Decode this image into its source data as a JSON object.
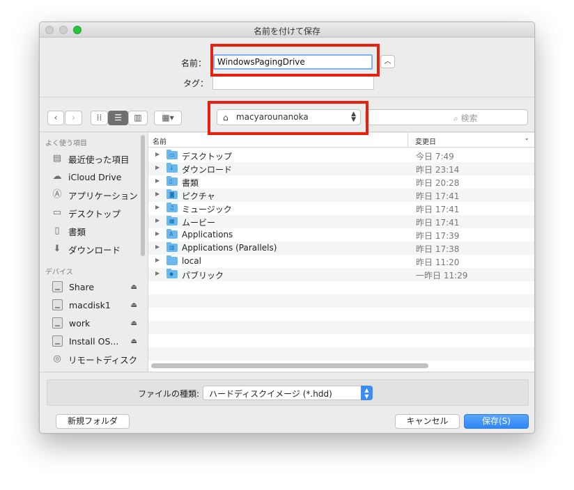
{
  "window": {
    "title": "名前を付けて保存"
  },
  "save_form": {
    "name_label": "名前：",
    "name_value": "WindowsPagingDrive",
    "tag_label": "タグ：",
    "tag_value": "",
    "expand_icon": "chevron-up-icon"
  },
  "toolbar": {
    "back_icon": "‹",
    "forward_icon": "›",
    "location": "macyarounanoka",
    "search_placeholder": "検索"
  },
  "sidebar": {
    "favorites_header": "よく使う項目",
    "favorites": [
      {
        "label": "最近使った項目",
        "icon": "recent-icon"
      },
      {
        "label": "iCloud Drive",
        "icon": "cloud-icon"
      },
      {
        "label": "アプリケーション",
        "icon": "applications-icon"
      },
      {
        "label": "デスクトップ",
        "icon": "desktop-icon"
      },
      {
        "label": "書類",
        "icon": "documents-icon"
      },
      {
        "label": "ダウンロード",
        "icon": "download-icon"
      }
    ],
    "devices_header": "デバイス",
    "devices": [
      {
        "label": "Share",
        "icon": "disk-icon"
      },
      {
        "label": "macdisk1",
        "icon": "disk-icon"
      },
      {
        "label": "work",
        "icon": "disk-icon"
      },
      {
        "label": "Install OS...",
        "icon": "disk-icon"
      },
      {
        "label": "リモートディスク",
        "icon": "remote-disc-icon"
      }
    ]
  },
  "file_list": {
    "col_name": "名前",
    "col_date": "変更日",
    "rows": [
      {
        "name": "デスクトップ",
        "date": "今日 7:49",
        "glyph": "▭"
      },
      {
        "name": "ダウンロード",
        "date": "昨日 23:14",
        "glyph": "↓"
      },
      {
        "name": "書類",
        "date": "昨日 20:28",
        "glyph": "▯"
      },
      {
        "name": "ピクチャ",
        "date": "昨日 17:41",
        "glyph": "◙"
      },
      {
        "name": "ミュージック",
        "date": "昨日 17:41",
        "glyph": "♫"
      },
      {
        "name": "ムービー",
        "date": "昨日 17:41",
        "glyph": "▦"
      },
      {
        "name": "Applications",
        "date": "昨日 17:39",
        "glyph": "A"
      },
      {
        "name": "Applications (Parallels)",
        "date": "昨日 17:38",
        "glyph": "▥"
      },
      {
        "name": "local",
        "date": "昨日 11:20",
        "glyph": ""
      },
      {
        "name": "パブリック",
        "date": "一昨日 11:29",
        "glyph": "◆"
      }
    ]
  },
  "format": {
    "label": "ファイルの種類:",
    "value": "ハードディスクイメージ (*.hdd)"
  },
  "buttons": {
    "new_folder": "新規フォルダ",
    "cancel": "キャンセル",
    "save": "保存(S)"
  },
  "colors": {
    "highlight_box": "#e8210e",
    "accent": "#3b8cf5",
    "folder": "#69b8ee"
  }
}
